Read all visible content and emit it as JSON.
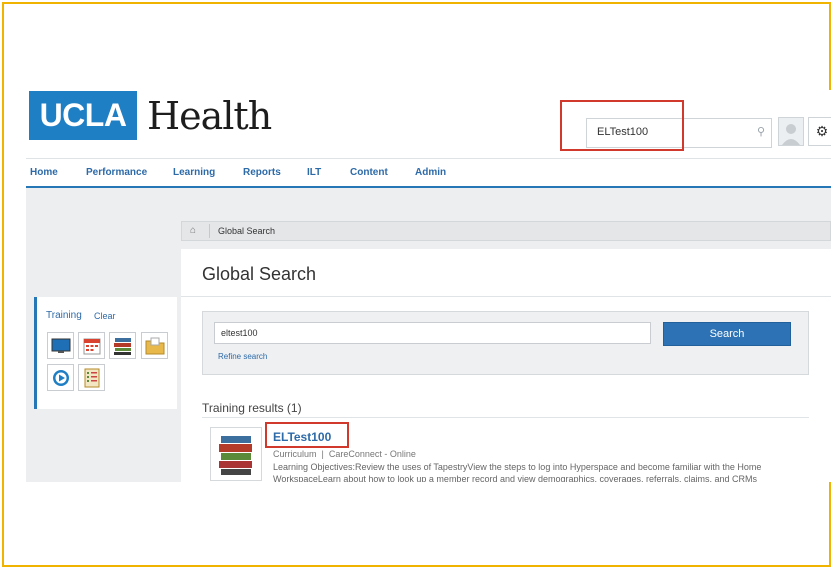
{
  "header": {
    "logo_box_text": "UCLA",
    "logo_word": "Health",
    "search_value": "ELTest100"
  },
  "nav": {
    "items": [
      "Home",
      "Performance",
      "Learning",
      "Reports",
      "ILT",
      "Content",
      "Admin"
    ],
    "active": "Home"
  },
  "sidebar": {
    "title": "Training",
    "clear_label": "Clear",
    "icons": [
      "monitor-icon",
      "calendar-icon",
      "books-icon",
      "folder-icon",
      "video-play-icon",
      "checklist-icon"
    ]
  },
  "breadcrumb": {
    "current": "Global Search"
  },
  "main": {
    "title": "Global Search",
    "search_value": "eltest100",
    "search_button": "Search",
    "refine_label": "Refine search",
    "results_heading": "Training results (1)",
    "result": {
      "title": "ELTest100",
      "type": "Curriculum",
      "provider": "CareConnect - Online",
      "meta_separator": "|",
      "description_line1": "Learning Objectives:Review the uses of TapestryView the steps to log into Hyperspace and become familiar with the Home",
      "description_line2": "WorkspaceLearn about how to look up a member record and view demographics, coverages, referrals, claims, and CRMs"
    }
  },
  "colors": {
    "brand_blue": "#1f7fc4",
    "link_blue": "#2d6aa8",
    "highlight_red": "#d0392b",
    "frame_yellow": "#f0b400"
  }
}
